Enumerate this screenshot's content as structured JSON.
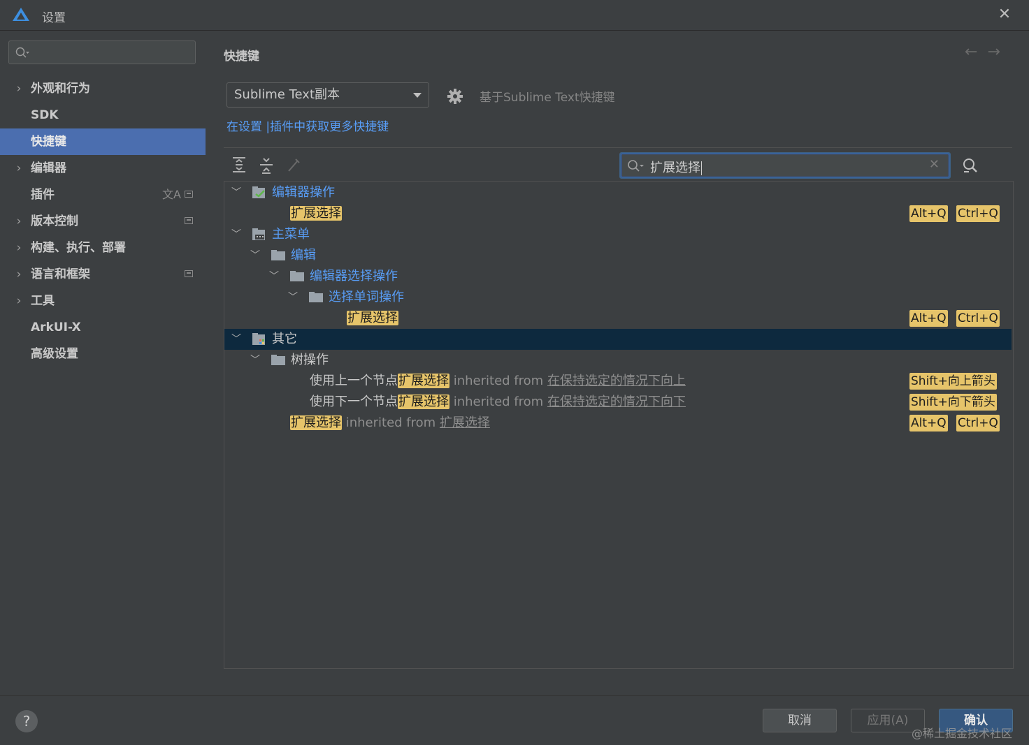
{
  "window": {
    "title": "设置"
  },
  "sidebar": {
    "items": [
      {
        "label": "外观和行为",
        "expandable": true
      },
      {
        "label": "SDK",
        "expandable": false
      },
      {
        "label": "快捷键",
        "expandable": false,
        "selected": true
      },
      {
        "label": "编辑器",
        "expandable": true
      },
      {
        "label": "插件",
        "expandable": false
      },
      {
        "label": "版本控制",
        "expandable": true
      },
      {
        "label": "构建、执行、部署",
        "expandable": true
      },
      {
        "label": "语言和框架",
        "expandable": true
      },
      {
        "label": "工具",
        "expandable": true
      },
      {
        "label": "ArkUI-X",
        "expandable": false
      },
      {
        "label": "高级设置",
        "expandable": false
      }
    ]
  },
  "main": {
    "title": "快捷键",
    "keymap": "Sublime Text副本",
    "based_on": "基于Sublime Text快捷键",
    "link": "在设置 |插件中获取更多快捷键",
    "search_value": "扩展选择"
  },
  "tree": {
    "nodes": [
      {
        "label": "编辑器操作"
      },
      {
        "hl": "扩展选择",
        "keys": [
          "Alt+Q",
          "Ctrl+Q"
        ]
      },
      {
        "label": "主菜单"
      },
      {
        "label": "编辑"
      },
      {
        "label": "编辑器选择操作"
      },
      {
        "label": "选择单词操作"
      },
      {
        "hl": "扩展选择",
        "keys": [
          "Alt+Q",
          "Ctrl+Q"
        ]
      },
      {
        "label": "其它"
      },
      {
        "label": "树操作"
      },
      {
        "prefix": "使用上一个节点",
        "hl": "扩展选择",
        "inherited": "inherited from",
        "from": "在保持选定的情况下向上",
        "keys": [
          "Shift+向上箭头"
        ]
      },
      {
        "prefix": "使用下一个节点",
        "hl": "扩展选择",
        "inherited": "inherited from",
        "from": "在保持选定的情况下向下",
        "keys": [
          "Shift+向下箭头"
        ]
      },
      {
        "hl": "扩展选择",
        "inherited": "inherited from",
        "from": "扩展选择",
        "keys": [
          "Alt+Q",
          "Ctrl+Q"
        ]
      }
    ]
  },
  "footer": {
    "help": "?",
    "cancel": "取消",
    "apply": "应用(A)",
    "ok": "确认",
    "watermark": "@稀土掘金技术社区"
  },
  "colors": {
    "accent": "#4b6eaf",
    "highlight": "#e6c46a",
    "link": "#589df6",
    "selected_row": "#0d293e"
  }
}
